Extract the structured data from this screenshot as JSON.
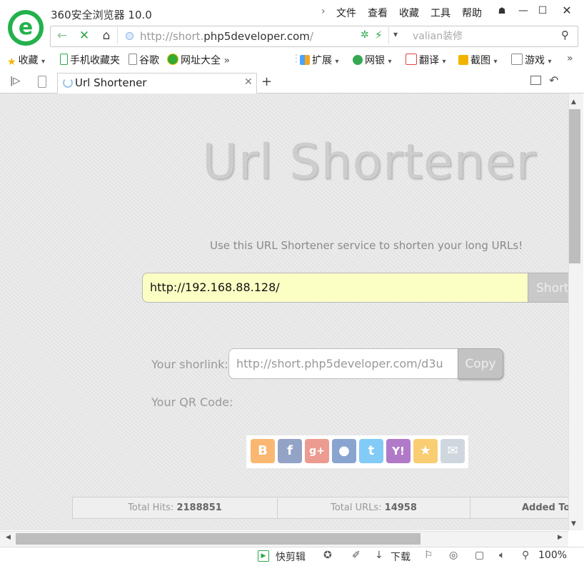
{
  "window": {
    "title": "360安全浏览器 10.0",
    "menus": [
      "文件",
      "查看",
      "收藏",
      "工具",
      "帮助"
    ]
  },
  "address": {
    "url_prefix": "http://short.",
    "url_domain": "php5developer.com",
    "url_suffix": "/",
    "search_placeholder": "valian装修"
  },
  "bookmarks": {
    "left": [
      "收藏",
      "手机收藏夹",
      "谷歌",
      "网址大全"
    ],
    "right": [
      "扩展",
      "网银",
      "翻译",
      "截图",
      "游戏"
    ]
  },
  "tab": {
    "title": "Url Shortener"
  },
  "page": {
    "heading": "Url Shortener",
    "subtitle": "Use this URL Shortener service to shorten your long URLs!",
    "long_url_value": "http://192.168.88.128/",
    "shorten_label": "Short",
    "shortlink_label": "Your shorlink:",
    "shortlink_value": "http://short.php5developer.com/d3u",
    "copy_label": "Copy",
    "qr_label": "Your QR Code:",
    "share_icons": [
      "blogger-icon",
      "facebook-icon",
      "google-plus-icon",
      "myspace-icon",
      "twitter-icon",
      "yahoo-icon",
      "favorites-star-icon",
      "email-icon"
    ],
    "stats": [
      {
        "label": "Total Hits:",
        "value": "2188851"
      },
      {
        "label": "Total URLs:",
        "value": "14958"
      },
      {
        "label": "Added Tod",
        "value": ""
      }
    ]
  },
  "statusbar": {
    "clip_label": "快剪辑",
    "download_label": "下载",
    "zoom": "100%"
  },
  "colors": {
    "brand_green": "#23b14d",
    "input_highlight": "#fcffc4",
    "page_bg": "#e9e9e9"
  }
}
